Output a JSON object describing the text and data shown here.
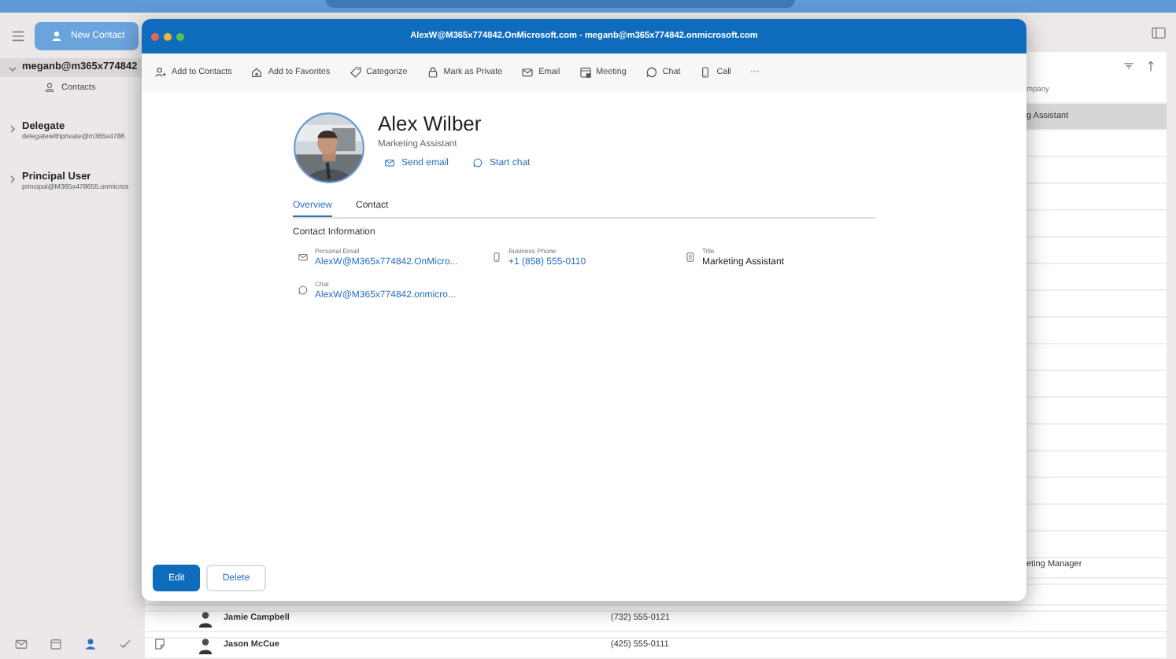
{
  "sidebar": {
    "new_button": "New Contact",
    "accounts": [
      {
        "name": "meganb@m365x774842",
        "expanded": true,
        "selected": true,
        "children": [
          {
            "label": "Contacts"
          }
        ]
      },
      {
        "name": "Delegate",
        "email": "delegatewithprivate@m365x4786",
        "expanded": false,
        "selected": false
      },
      {
        "name": "Principal User",
        "email": "principal@M365x478655.onmicros",
        "expanded": false,
        "selected": false
      }
    ],
    "nav": [
      {
        "kind": "mail",
        "selected": false
      },
      {
        "kind": "calendar",
        "selected": false
      },
      {
        "kind": "people",
        "selected": true
      },
      {
        "kind": "tasks",
        "selected": false
      },
      {
        "kind": "notes",
        "selected": false
      }
    ]
  },
  "list": {
    "column_3": "mpany",
    "top_rows": [
      {
        "company": "g Assistant",
        "selected": true
      }
    ],
    "mid_rows": [
      {
        "company": "eting Manager",
        "selected": false
      }
    ],
    "bottom_rows": [
      {
        "name": "Jamie Campbell",
        "phone": "(732) 555-0121",
        "selected": false
      },
      {
        "name": "Jason McCue",
        "phone": "(425) 555-0111",
        "selected": false
      }
    ]
  },
  "dialog": {
    "title": "AlexW@M365x774842.OnMicrosoft.com - meganb@m365x774842.onmicrosoft.com",
    "toolbar": [
      {
        "kind": "person-add",
        "label": "Add to Contacts"
      },
      {
        "kind": "favorite",
        "label": "Add to Favorites"
      },
      {
        "kind": "tag",
        "label": "Categorize"
      },
      {
        "kind": "lock",
        "label": "Mark as Private"
      },
      {
        "kind": "mail",
        "label": "Email"
      },
      {
        "kind": "meeting",
        "label": "Meeting"
      },
      {
        "kind": "chat",
        "label": "Chat"
      },
      {
        "kind": "phone",
        "label": "Call"
      },
      {
        "kind": "more",
        "label": "···"
      }
    ],
    "contact": {
      "name": "Alex Wilber",
      "job": "Marketing Assistant",
      "actions": [
        {
          "kind": "mail",
          "label": "Send email"
        },
        {
          "kind": "chat",
          "label": "Start chat"
        }
      ]
    },
    "tabs": [
      {
        "label": "Overview",
        "selected": true
      },
      {
        "label": "Contact",
        "selected": false
      }
    ],
    "section": "Contact Information",
    "fields": [
      {
        "kind": "mail",
        "label": "Personal Email",
        "value": "AlexW@M365x774842.OnMicro..."
      },
      {
        "kind": "phone",
        "label": "Business Phone",
        "value": "+1 (858) 555-0110"
      },
      {
        "kind": "title",
        "label": "Title",
        "value": "Marketing Assistant"
      },
      {
        "kind": "chat",
        "label": "Chat",
        "value": "AlexW@M365x774842.onmicro..."
      }
    ],
    "buttons": [
      {
        "kind": "primary",
        "label": "Edit"
      },
      {
        "kind": "secondary",
        "label": "Delete"
      }
    ]
  }
}
